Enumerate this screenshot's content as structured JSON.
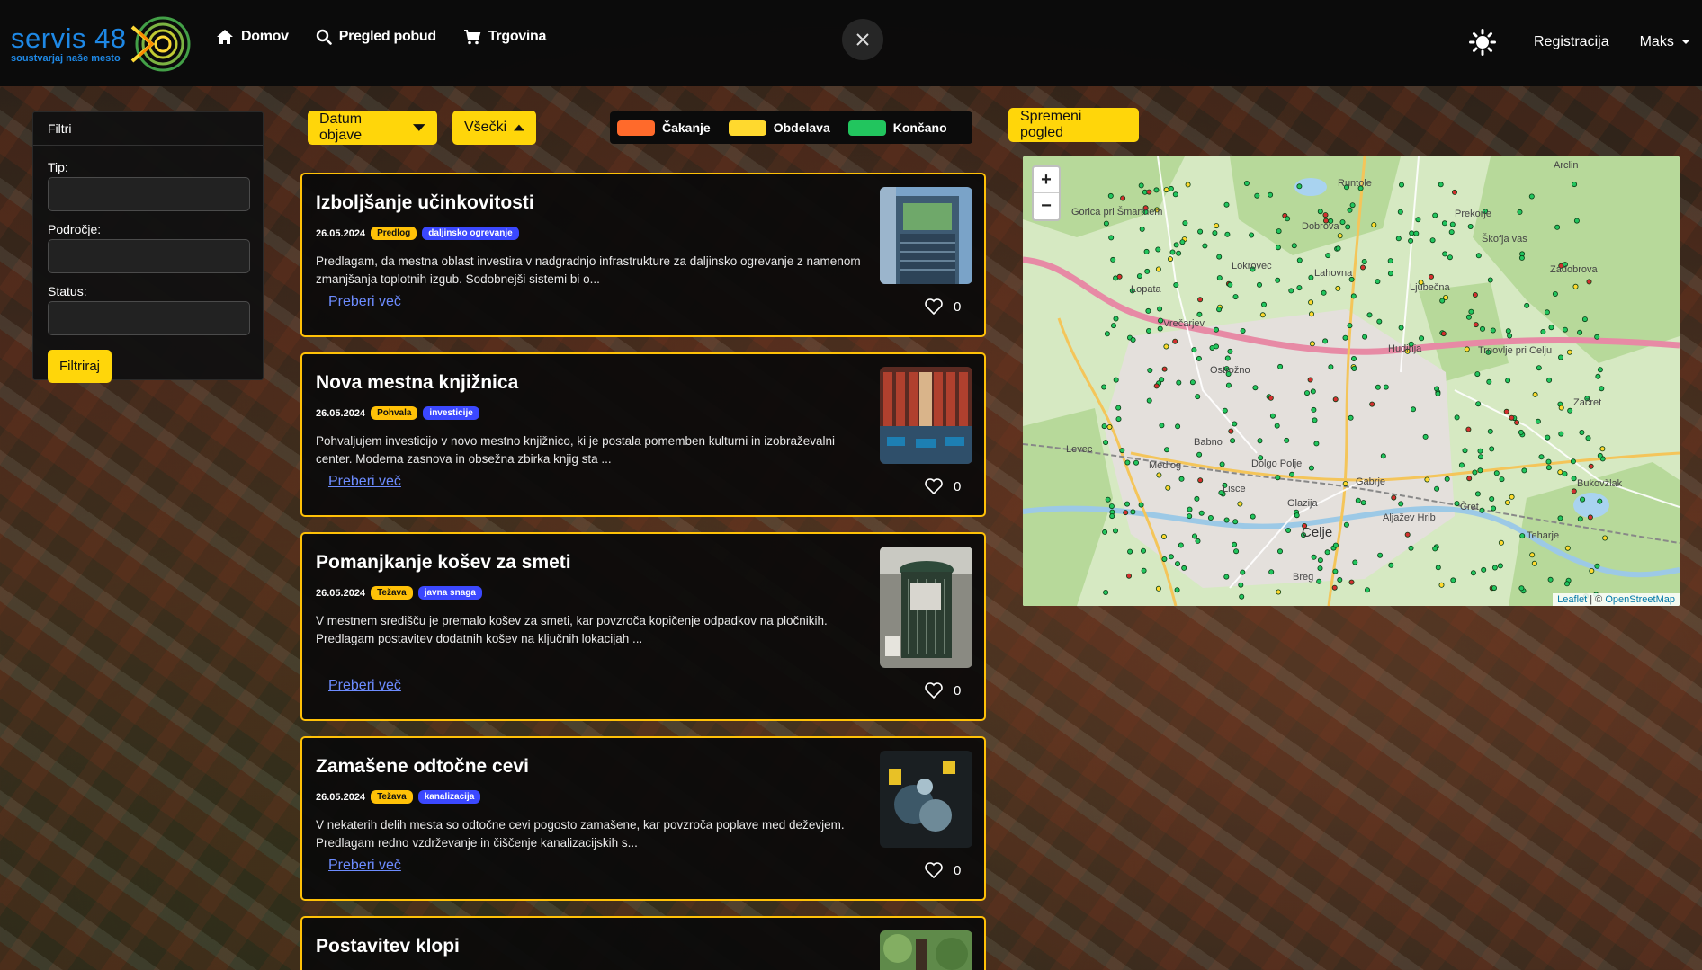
{
  "brand": {
    "name": "servis 48",
    "tagline": "soustvarjaj naše mesto"
  },
  "nav": {
    "links": [
      {
        "label": "Domov",
        "icon": "home-icon"
      },
      {
        "label": "Pregled pobud",
        "icon": "search-icon"
      },
      {
        "label": "Trgovina",
        "icon": "cart-icon"
      }
    ],
    "register": "Registracija",
    "user": "Maks"
  },
  "filters": {
    "title": "Filtri",
    "type_label": "Tip:",
    "area_label": "Področje:",
    "status_label": "Status:",
    "submit": "Filtriraj"
  },
  "controls": {
    "sort": "Datum objave",
    "scope": "Všečki",
    "change_view": "Spremeni pogled"
  },
  "legend": [
    {
      "label": "Čakanje",
      "color": "#ff6a2b"
    },
    {
      "label": "Obdelava",
      "color": "#ffd92e"
    },
    {
      "label": "Končano",
      "color": "#22c55e"
    }
  ],
  "posts": [
    {
      "title": "Izboljšanje učinkovitosti",
      "date": "26.05.2024",
      "type": "Predlog",
      "category": "daljinsko ogrevanje",
      "excerpt": "Predlagam, da mestna oblast investira v nadgradnjo infrastrukture za daljinsko ogrevanje z namenom zmanjšanja toplotnih izgub. Sodobnejši sistemi bi o...",
      "more": "Preberi več",
      "likes": "0"
    },
    {
      "title": "Nova mestna knjižnica",
      "date": "26.05.2024",
      "type": "Pohvala",
      "category": "investicije",
      "excerpt": "Pohvaljujem investicijo v novo mestno knjižnico, ki je postala pomemben kulturni in izobraževalni center. Moderna zasnova in obsežna zbirka knjig sta ...",
      "more": "Preberi več",
      "likes": "0"
    },
    {
      "title": "Pomanjkanje košev za smeti",
      "date": "26.05.2024",
      "type": "Težava",
      "category": "javna snaga",
      "excerpt": "V mestnem središču je premalo košev za smeti, kar povzroča kopičenje odpadkov na pločnikih. Predlagam postavitev dodatnih košev na ključnih lokacijah ...",
      "more": "Preberi več",
      "likes": "0"
    },
    {
      "title": "Zamašene odtočne cevi",
      "date": "26.05.2024",
      "type": "Težava",
      "category": "kanalizacija",
      "excerpt": "V nekaterih delih mesta so odtočne cevi pogosto zamašene, kar povzroča poplave med deževjem. Predlagam redno vzdrževanje in čiščenje kanalizacijskih s...",
      "more": "Preberi več",
      "likes": "0"
    },
    {
      "title": "Postavitev klopi"
    }
  ],
  "map": {
    "zoom_in": "+",
    "zoom_out": "−",
    "attribution_leaflet": "Leaflet",
    "attribution_sep": " | © ",
    "attribution_osm": "OpenStreetMap",
    "places": {
      "celje": "Celje",
      "gabrje": "Gabrje",
      "lisce": "Lisce",
      "medlog": "Medlog",
      "babno": "Babno",
      "levec": "Levec",
      "lopata": "Lopata",
      "dobrova": "Dobrova",
      "ljubecna": "Ljubečna",
      "zadobrova": "Zadobrova",
      "zacret": "Začret",
      "teharje": "Teharje",
      "bukovzlak": "Bukovžlak",
      "lahovna": "Lahovna",
      "hudinja": "Hudinja",
      "ostrozno": "Ostrožno",
      "glazija": "Glazija",
      "dolgo_polje": "Dolgo Polje",
      "prekorje": "Prekorje",
      "runtole": "Runtole",
      "arclin": "Arclin",
      "gorica": "Gorica pri Šmartnem",
      "skofja_vas": "Škofja vas",
      "trnovlje": "Trnovlje pri Celju",
      "aljazev_hrib": "Aljažev Hrib",
      "cret": "Čret",
      "brezova": "Breg",
      "lokrovec": "Lokrovec",
      "vrecarjev": "Vrečarjev"
    }
  }
}
